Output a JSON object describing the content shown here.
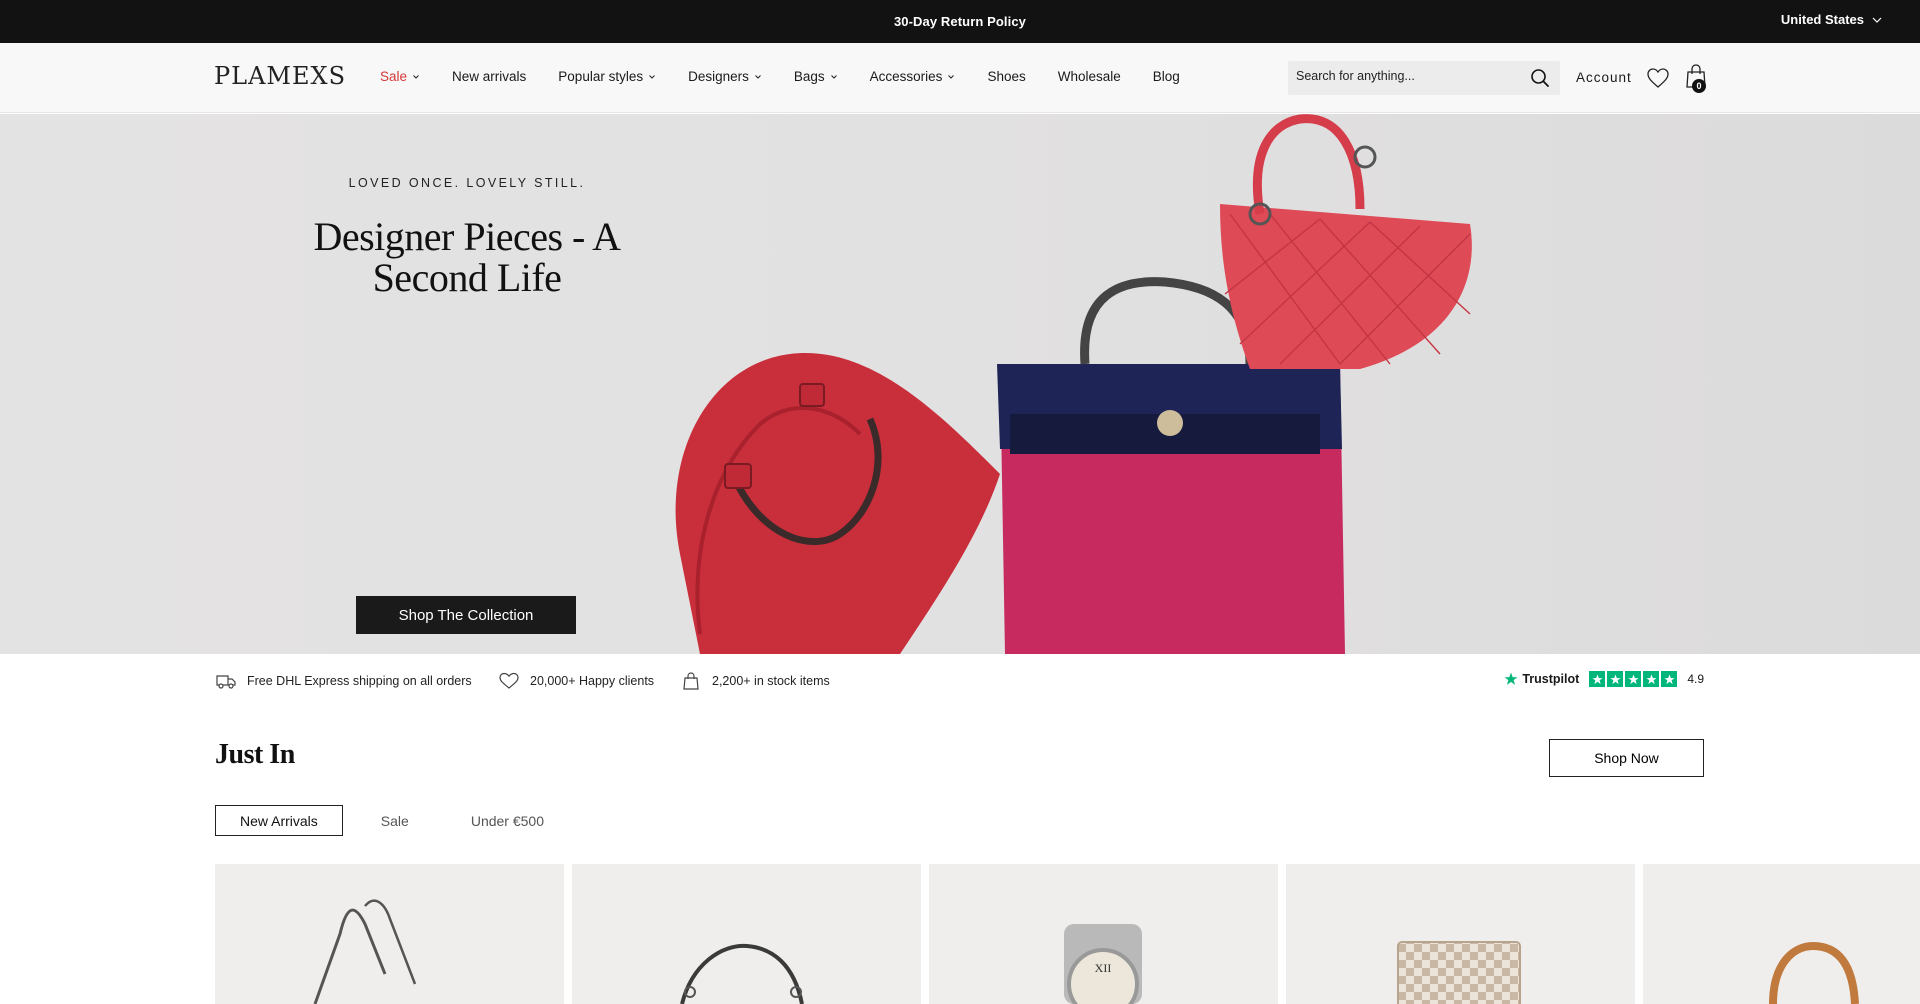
{
  "topbar": {
    "policy": "30-Day Return Policy",
    "country": "United States"
  },
  "header": {
    "logo": "PLAMEXS",
    "nav": [
      {
        "label": "Sale",
        "has_dropdown": true,
        "color": "#d43838"
      },
      {
        "label": "New arrivals",
        "has_dropdown": false
      },
      {
        "label": "Popular styles",
        "has_dropdown": true
      },
      {
        "label": "Designers",
        "has_dropdown": true
      },
      {
        "label": "Bags",
        "has_dropdown": true
      },
      {
        "label": "Accessories",
        "has_dropdown": true
      },
      {
        "label": "Shoes",
        "has_dropdown": false
      },
      {
        "label": "Wholesale",
        "has_dropdown": false
      },
      {
        "label": "Blog",
        "has_dropdown": false
      }
    ],
    "search_placeholder": "Search for anything...",
    "account": "Account",
    "cart_count": "0",
    "icons": [
      "search-icon",
      "heart-icon",
      "shopping-bag-icon",
      "chevron-down-icon"
    ]
  },
  "hero": {
    "eyebrow": "LOVED ONCE. LOVELY STILL.",
    "title": "Designer Pieces - A Second Life",
    "cta": "Shop The Collection"
  },
  "usp": {
    "items": [
      {
        "icon": "truck-icon",
        "text": "Free DHL Express shipping on all orders"
      },
      {
        "icon": "heart-icon",
        "text": "20,000+ Happy clients"
      },
      {
        "icon": "shopping-bag-icon",
        "text": "2,200+ in stock items"
      }
    ],
    "trustpilot": {
      "label": "Trustpilot",
      "rating": "4.9",
      "stars": 5,
      "color": "#00b67a"
    }
  },
  "just_in": {
    "title": "Just In",
    "shop_now": "Shop Now",
    "tabs": [
      "New Arrivals",
      "Sale",
      "Under €500"
    ],
    "active_tab": "New Arrivals"
  }
}
